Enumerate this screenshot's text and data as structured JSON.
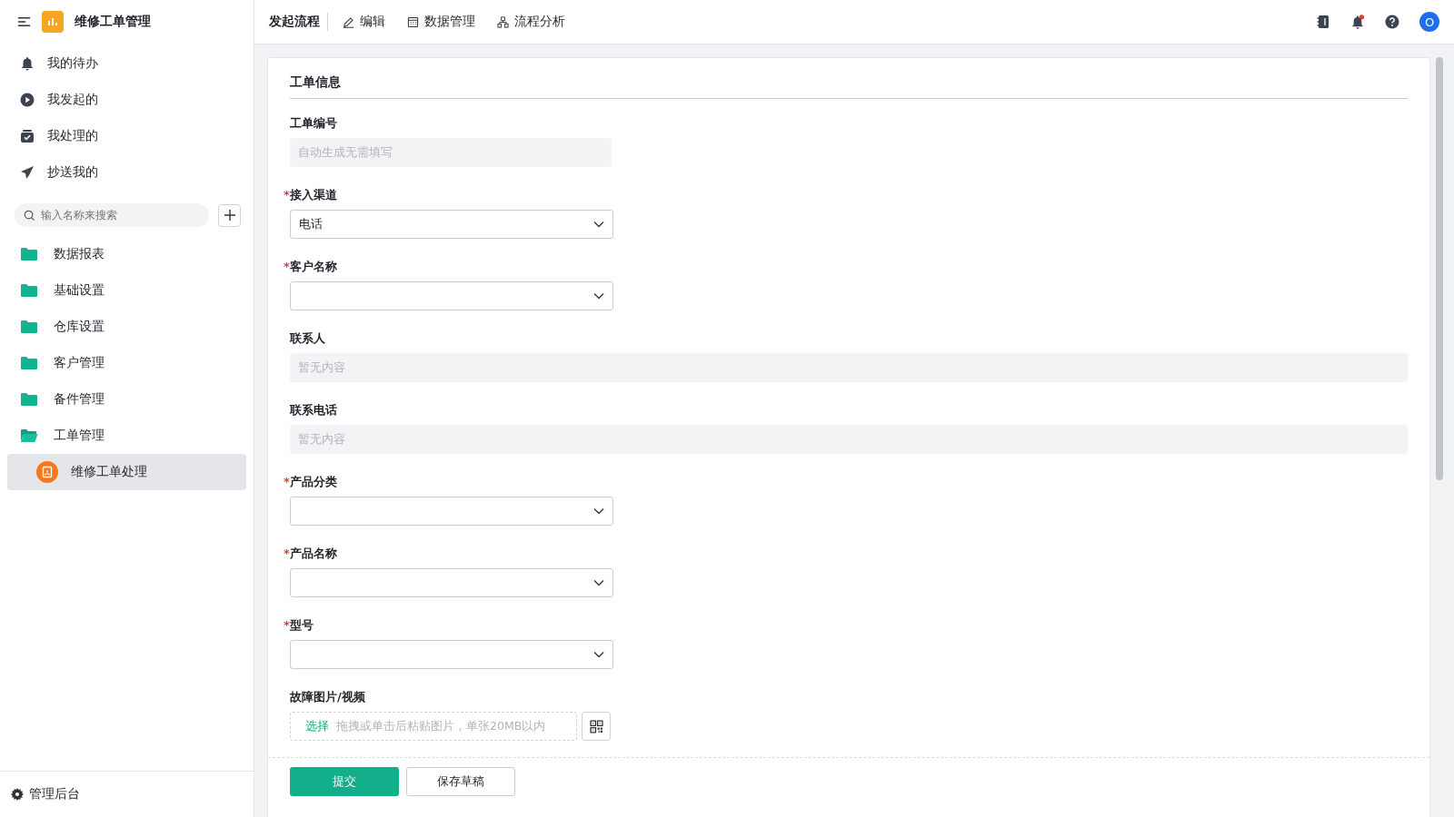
{
  "app": {
    "title": "维修工单管理"
  },
  "quick_nav": [
    {
      "kind": "todo",
      "label": "我的待办"
    },
    {
      "kind": "started",
      "label": "我发起的"
    },
    {
      "kind": "handled",
      "label": "我处理的"
    },
    {
      "kind": "cc",
      "label": "抄送我的"
    }
  ],
  "search": {
    "placeholder": "输入名称来搜索"
  },
  "tree": [
    {
      "label": "数据报表",
      "expanded": false,
      "selected": false
    },
    {
      "label": "基础设置",
      "expanded": false,
      "selected": false
    },
    {
      "label": "仓库设置",
      "expanded": false,
      "selected": false
    },
    {
      "label": "客户管理",
      "expanded": false,
      "selected": false
    },
    {
      "label": "备件管理",
      "expanded": false,
      "selected": false
    },
    {
      "label": "工单管理",
      "expanded": true,
      "selected": false,
      "children": [
        {
          "label": "维修工单处理",
          "selected": true
        }
      ]
    }
  ],
  "admin_link": "管理后台",
  "top_tabs": [
    {
      "kind": "start",
      "label": "发起流程",
      "selected": true
    },
    {
      "kind": "edit",
      "label": "编辑",
      "selected": false
    },
    {
      "kind": "data",
      "label": "数据管理",
      "selected": false
    },
    {
      "kind": "flow",
      "label": "流程分析",
      "selected": false
    }
  ],
  "user": {
    "initial": "O",
    "has_notification": true
  },
  "form": {
    "section_title": "工单信息",
    "required_mark": "*",
    "fields": [
      {
        "kind": "readonly",
        "label": "工单编号",
        "required": false,
        "placeholder": "自动生成无需填写"
      },
      {
        "kind": "select",
        "label": "接入渠道",
        "required": true,
        "value": "电话"
      },
      {
        "kind": "select",
        "label": "客户名称",
        "required": true
      },
      {
        "kind": "readonly-wide",
        "label": "联系人",
        "required": false,
        "placeholder": "暂无内容"
      },
      {
        "kind": "readonly-wide",
        "label": "联系电话",
        "required": false,
        "placeholder": "暂无内容"
      },
      {
        "kind": "select",
        "label": "产品分类",
        "required": true
      },
      {
        "kind": "select",
        "label": "产品名称",
        "required": true
      },
      {
        "kind": "select",
        "label": "型号",
        "required": true
      },
      {
        "kind": "upload",
        "label": "故障图片/视频",
        "required": false,
        "action": "选择",
        "hint": "拖拽或单击后粘贴图片，单张20MB以内"
      }
    ],
    "buttons": [
      {
        "kind": "primary",
        "label": "提交"
      },
      {
        "kind": "default",
        "label": "保存草稿"
      }
    ]
  }
}
